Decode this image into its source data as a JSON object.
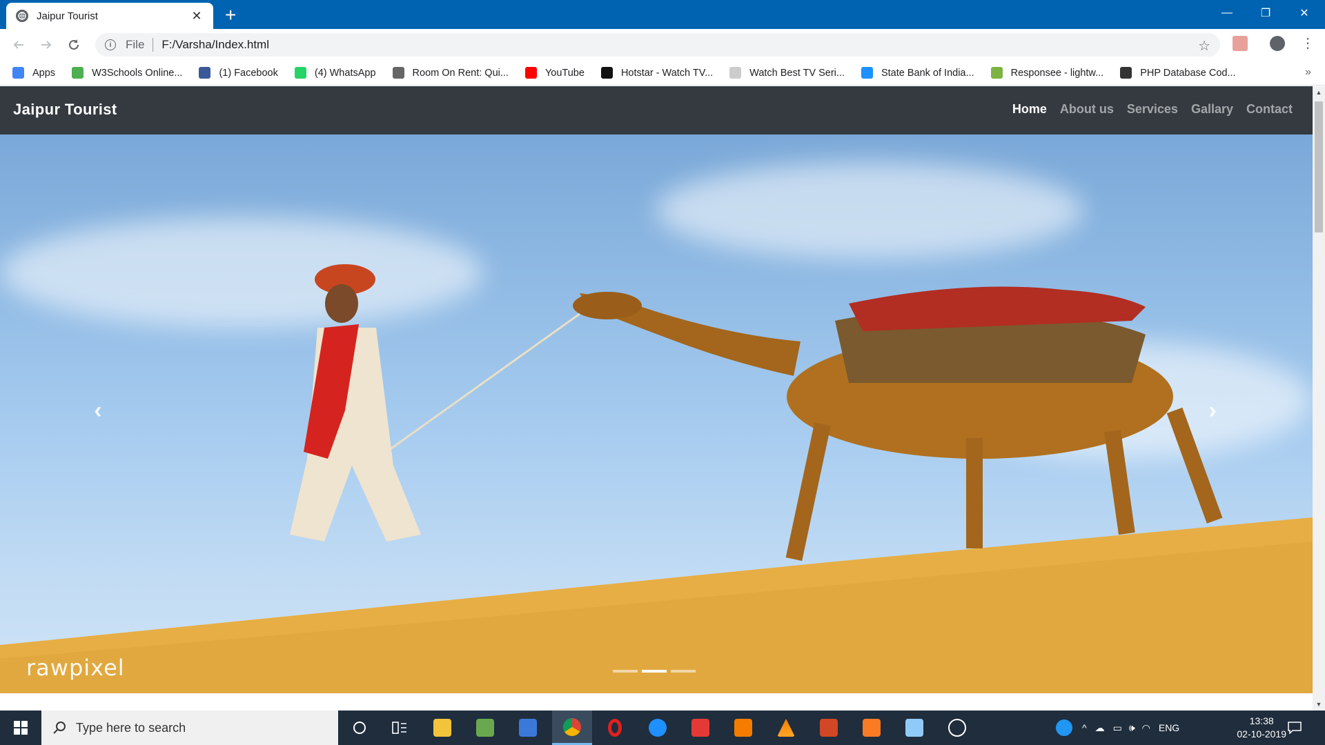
{
  "browser": {
    "tab_title": "Jaipur Tourist",
    "tab_close": "✕",
    "new_tab": "+",
    "window_controls": {
      "minimize": "—",
      "restore": "❐",
      "close": "✕"
    },
    "scheme": "File",
    "url": "F:/Varsha/Index.html",
    "bookmarks": [
      {
        "label": "Apps",
        "icon": "apps-grid-icon",
        "color": "#4285f4"
      },
      {
        "label": "W3Schools Online...",
        "icon": "w3schools-icon",
        "color": "#4caf50"
      },
      {
        "label": "(1) Facebook",
        "icon": "facebook-icon",
        "color": "#3b5998"
      },
      {
        "label": "(4) WhatsApp",
        "icon": "whatsapp-icon",
        "color": "#25d366"
      },
      {
        "label": "Room On Rent: Qui...",
        "icon": "house-icon",
        "color": "#666666"
      },
      {
        "label": "YouTube",
        "icon": "youtube-icon",
        "color": "#ff0000"
      },
      {
        "label": "Hotstar - Watch TV...",
        "icon": "hotstar-icon",
        "color": "#111111"
      },
      {
        "label": "Watch Best TV Seri...",
        "icon": "moon-icon",
        "color": "#cccccc"
      },
      {
        "label": "State Bank of India...",
        "icon": "sbi-icon",
        "color": "#1e90ff"
      },
      {
        "label": "Responsee - lightw...",
        "icon": "responsee-icon",
        "color": "#7cb342"
      },
      {
        "label": "PHP Database Cod...",
        "icon": "cursor-icon",
        "color": "#333333"
      }
    ],
    "more": "»"
  },
  "site": {
    "brand": "Jaipur Tourist",
    "nav": [
      {
        "label": "Home",
        "active": true
      },
      {
        "label": "About us",
        "active": false
      },
      {
        "label": "Services",
        "active": false
      },
      {
        "label": "Gallary",
        "active": false
      },
      {
        "label": "Contact",
        "active": false
      }
    ],
    "carousel": {
      "prev": "‹",
      "next": "›",
      "watermark": "rawpixel",
      "slides": 3,
      "active_slide": 2
    }
  },
  "taskbar": {
    "search_placeholder": "Type here to search",
    "tray_lang": "ENG",
    "time": "13:38",
    "date": "02-10-2019"
  }
}
